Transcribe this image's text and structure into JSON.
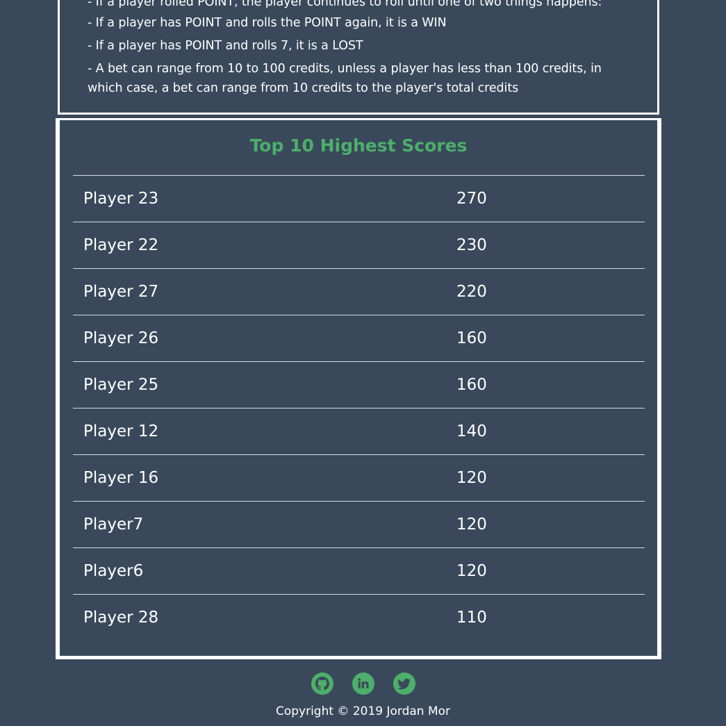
{
  "rules": [
    "- If a player rolled POINT, the player continues to roll until one of two things happens:",
    "- If a player has POINT and rolls the POINT again, it is a WIN",
    "- If a player has POINT and rolls 7, it is a LOST",
    "- A bet can range from 10 to 100 credits, unless a player has less than 100 credits, in which case, a bet can range from 10 credits to the player's total credits"
  ],
  "scores": {
    "title": "Top 10 Highest Scores",
    "rows": [
      {
        "name": "Player 23",
        "score": "270"
      },
      {
        "name": "Player 22",
        "score": "230"
      },
      {
        "name": "Player 27",
        "score": "220"
      },
      {
        "name": "Player 26",
        "score": "160"
      },
      {
        "name": "Player 25",
        "score": "160"
      },
      {
        "name": "Player 12",
        "score": "140"
      },
      {
        "name": "Player 16",
        "score": "120"
      },
      {
        "name": "Player7",
        "score": "120"
      },
      {
        "name": "Player6",
        "score": "120"
      },
      {
        "name": "Player 28",
        "score": "110"
      }
    ]
  },
  "footer": {
    "icons": [
      "github-icon",
      "linkedin-icon",
      "twitter-icon"
    ],
    "copyright": "Copyright © 2019 Jordan Mor"
  },
  "colors": {
    "background": "#39495b",
    "accent": "#4caf6a",
    "text": "#ffffff"
  }
}
